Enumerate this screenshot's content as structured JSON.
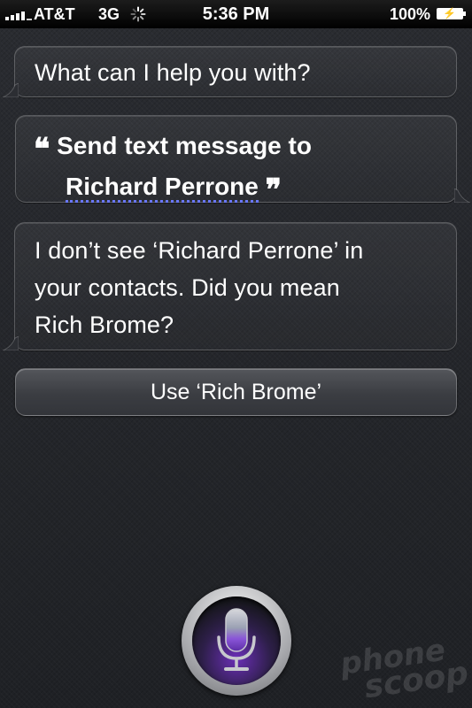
{
  "status_bar": {
    "carrier": "AT&T",
    "network": "3G",
    "time": "5:36 PM",
    "battery": "100%"
  },
  "conversation": {
    "prompt": "What can I help you with?",
    "user_quote_line1": "Send text message to",
    "user_quote_name": "Richard Perrone",
    "open_quote": "❝",
    "close_quote": "❞",
    "response_line1": "I don’t see ‘Richard Perrone’ in",
    "response_line2": "your contacts. Did you mean",
    "response_line3": "Rich Brome?"
  },
  "action_button": {
    "label": "Use ‘Rich Brome’"
  },
  "mic": {
    "icon": "microphone-icon",
    "glow_color": "#7a3ad0"
  },
  "watermark": {
    "line1": "phone",
    "line2": "scoop"
  }
}
